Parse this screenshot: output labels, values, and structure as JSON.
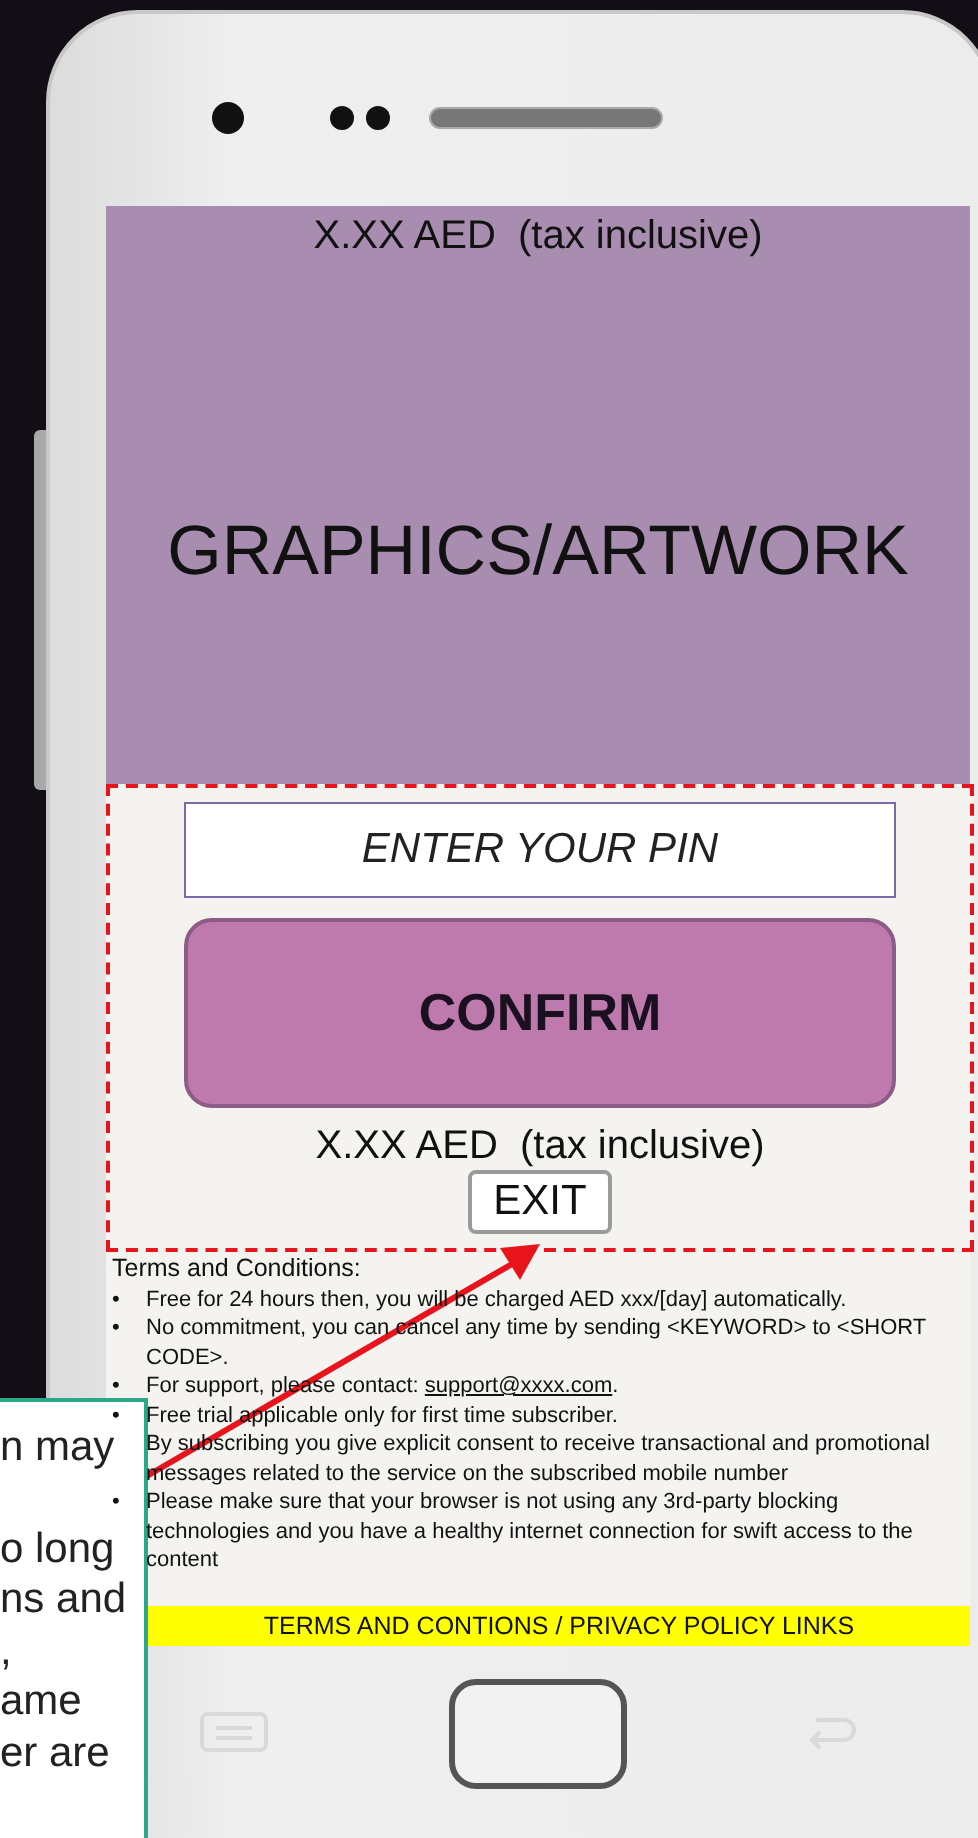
{
  "screen": {
    "price_top": "X.XX AED  (tax inclusive)",
    "artwork_label": "GRAPHICS/ARTWORK",
    "pin_field": {
      "placeholder": "ENTER YOUR PIN"
    },
    "confirm_button": "CONFIRM",
    "price_bottom": "X.XX AED  (tax inclusive)",
    "exit_button": "EXIT",
    "terms": {
      "heading": "Terms and Conditions:",
      "items": [
        {
          "bullet": "•",
          "text": "Free for 24 hours then, you will be charged AED xxx/[day] automatically."
        },
        {
          "bullet": "•",
          "text": "No commitment, you can cancel any time by sending <KEYWORD> to <SHORT CODE>."
        },
        {
          "bullet": "•",
          "text": "For support, please contact: ",
          "link": "support@xxxx.com",
          "after": "."
        },
        {
          "bullet": "•",
          "text": "Free trial applicable only for first time subscriber."
        },
        {
          "text": "By subscribing you give explicit consent to receive transactional and promotional messages related to the service on the subscribed mobile number"
        },
        {
          "bullet": "•",
          "text": "Please make sure that your browser is not using any 3rd-party blocking technologies and you have a healthy internet connection for swift access to the content"
        }
      ]
    },
    "footer_link": "TERMS AND CONTIONS / PRIVACY POLICY LINKS"
  },
  "note": {
    "paragraphs": [
      [
        "n may"
      ],
      [
        "o long",
        "ns and",
        ",",
        "ame",
        "er are"
      ]
    ]
  }
}
